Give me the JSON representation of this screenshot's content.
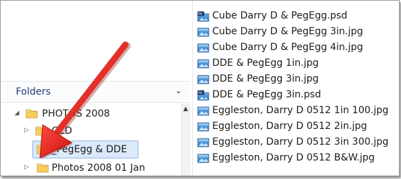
{
  "navigation_pane": {
    "header_label": "Folders",
    "header_icon": "chevron-down-icon",
    "tree": [
      {
        "label": "PHOTOS 2008",
        "expanded": true,
        "icon": "folder-icon"
      },
      {
        "label": "OLD",
        "expanded": false,
        "icon": "folder-icon"
      },
      {
        "label": "_PegEgg & DDE",
        "expanded": false,
        "selected": true,
        "icon": "folder-icon"
      },
      {
        "label": "Photos 2008 01 Jan",
        "expanded": false,
        "icon": "folder-icon"
      }
    ]
  },
  "file_list": {
    "files": [
      {
        "name": "Cube Darry D & PegEgg.psd",
        "type": "psd"
      },
      {
        "name": "Cube Darry D & PegEgg 3in.jpg",
        "type": "jpg"
      },
      {
        "name": "Cube Darry D & PegEgg 4in.jpg",
        "type": "jpg"
      },
      {
        "name": "DDE & PegEgg 1in.jpg",
        "type": "jpg"
      },
      {
        "name": "DDE & PegEgg 3in.jpg",
        "type": "jpg"
      },
      {
        "name": "DDE & PegEgg 3in.psd",
        "type": "psd"
      },
      {
        "name": "Eggleston, Darry D 0512 1in 100.jpg",
        "type": "jpg"
      },
      {
        "name": "Eggleston, Darry D 0512 2in.jpg",
        "type": "jpg"
      },
      {
        "name": "Eggleston, Darry D 0512 3in 300.jpg",
        "type": "jpg"
      },
      {
        "name": "Eggleston, Darry D 0512 B&W.jpg",
        "type": "jpg"
      }
    ]
  },
  "colors": {
    "annotation_arrow": "#e0201b",
    "selection_fill": "#dbe9fb",
    "selection_border": "#8fb6e6",
    "folder_yellow": "#f3c94a"
  }
}
